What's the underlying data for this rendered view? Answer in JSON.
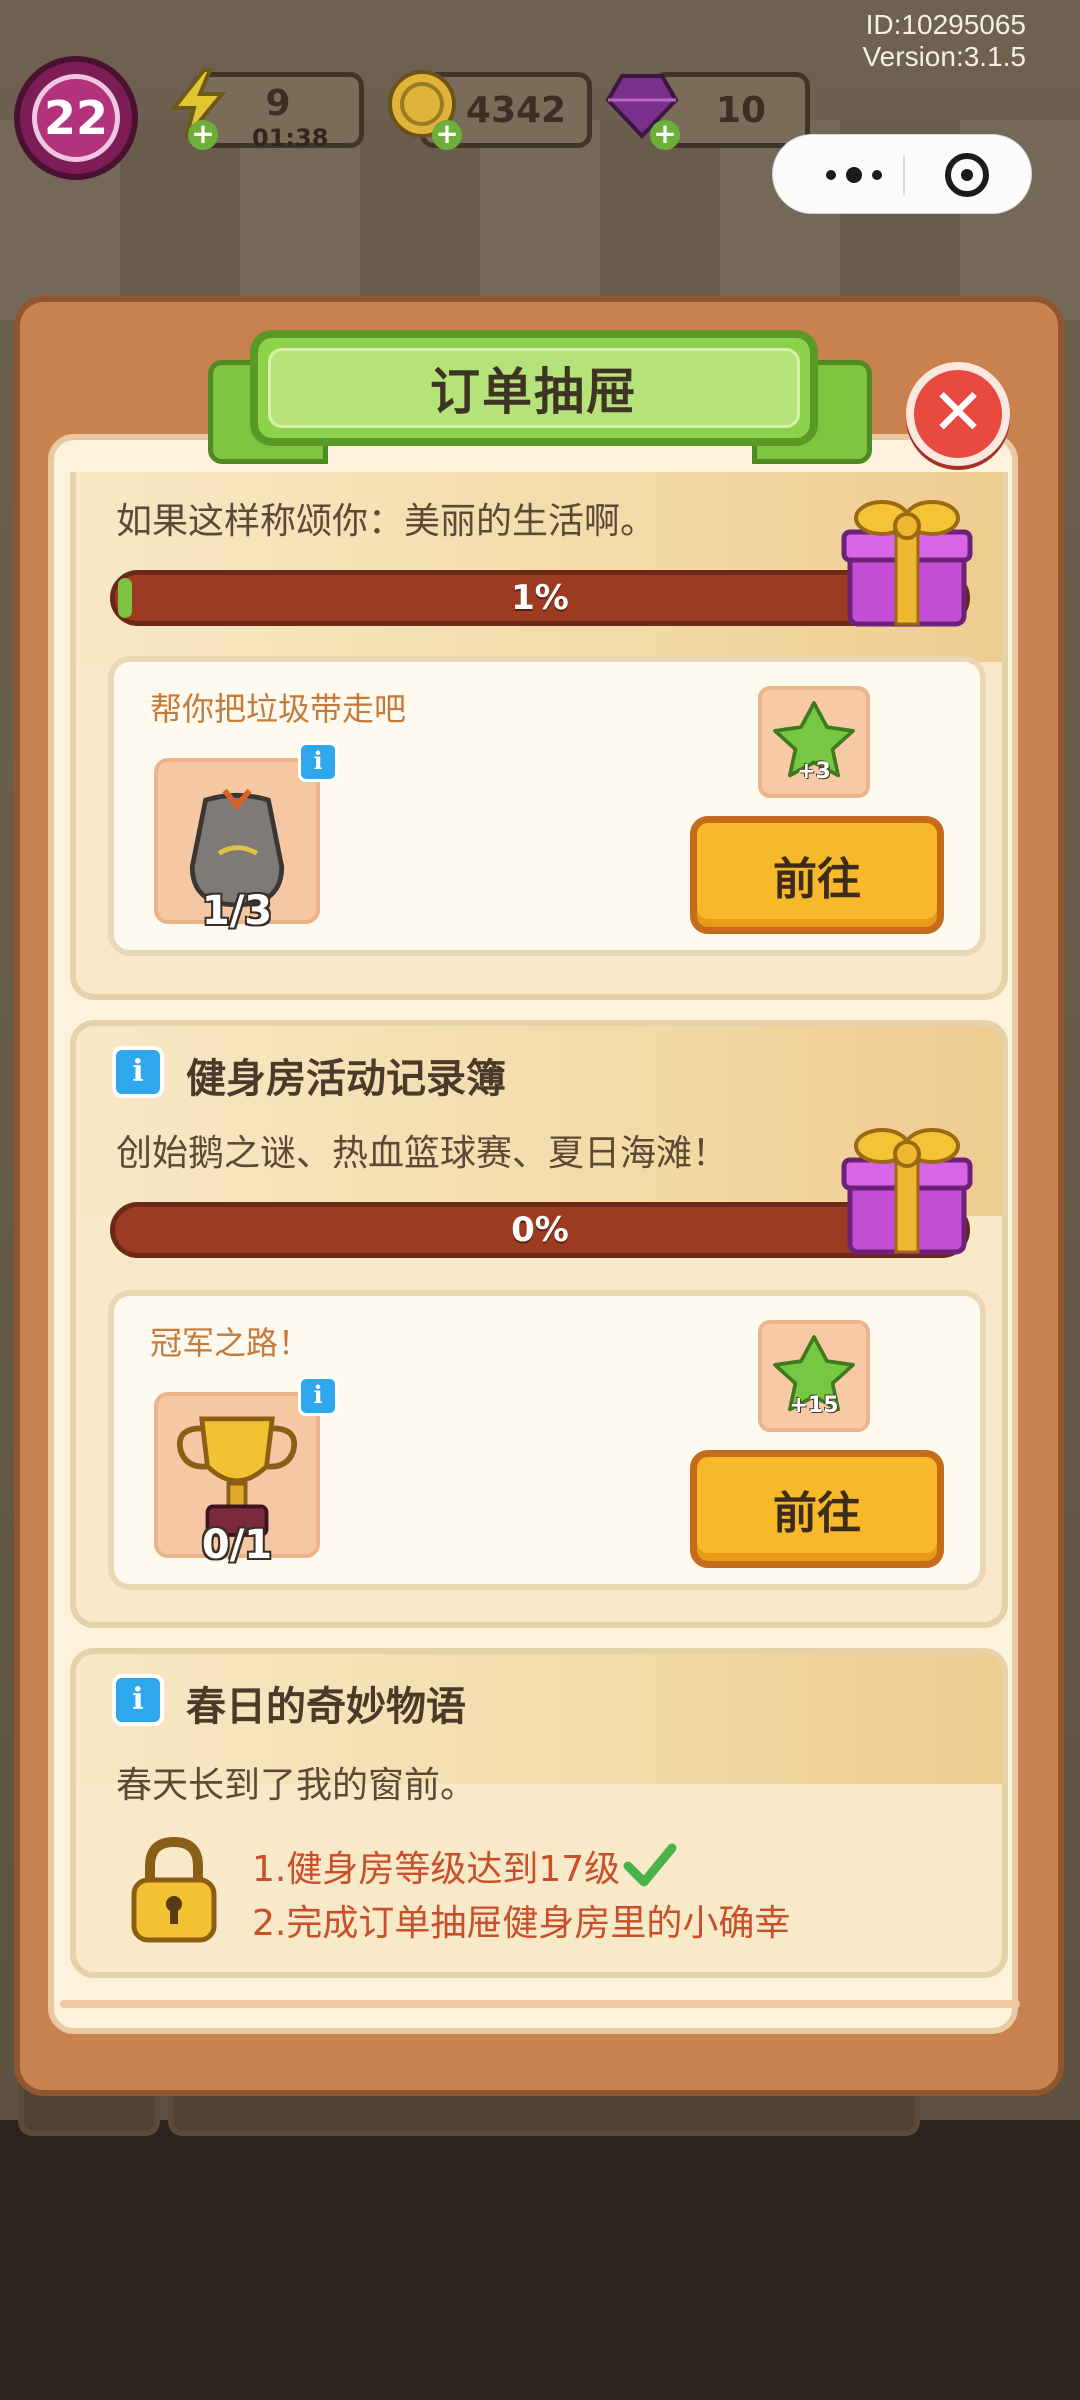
{
  "meta": {
    "id_text": "ID:10295065",
    "version_text": "Version:3.1.5"
  },
  "hud": {
    "level": "22",
    "energy": {
      "value": "9",
      "timer": "01:38",
      "icon": "lightning-icon"
    },
    "coins": {
      "value": "4342",
      "icon": "coin-icon"
    },
    "gems": {
      "value": "10",
      "icon": "gem-icon"
    }
  },
  "dialog": {
    "title": "订单抽屉",
    "sections": [
      {
        "title": "",
        "desc": "如果这样称颂你：美丽的生活啊。",
        "progress_label": "1%",
        "progress": 0.01,
        "task": {
          "title": "帮你把垃圾带走吧",
          "item_icon": "trash-bag-icon",
          "count": "1/3",
          "reward_icon": "green-leaf-icon",
          "reward_amount": "+3",
          "button": "前往"
        }
      },
      {
        "title": "健身房活动记录簿",
        "desc": "创始鹅之谜、热血篮球赛、夏日海滩！",
        "progress_label": "0%",
        "progress": 0.0,
        "task": {
          "title": "冠军之路！",
          "item_icon": "trophy-icon",
          "count": "0/1",
          "reward_icon": "green-leaf-icon",
          "reward_amount": "+15",
          "button": "前往"
        }
      },
      {
        "title": "春日的奇妙物语",
        "desc": "春天长到了我的窗前。",
        "requirements": [
          "1.健身房等级达到17级",
          "2.完成订单抽屉健身房里的小确幸"
        ]
      }
    ]
  },
  "colors": {
    "accent_green": "#8ed14a",
    "button_yellow": "#f7b92a",
    "progress_red": "#9c3b22",
    "close_red": "#e7493f"
  }
}
